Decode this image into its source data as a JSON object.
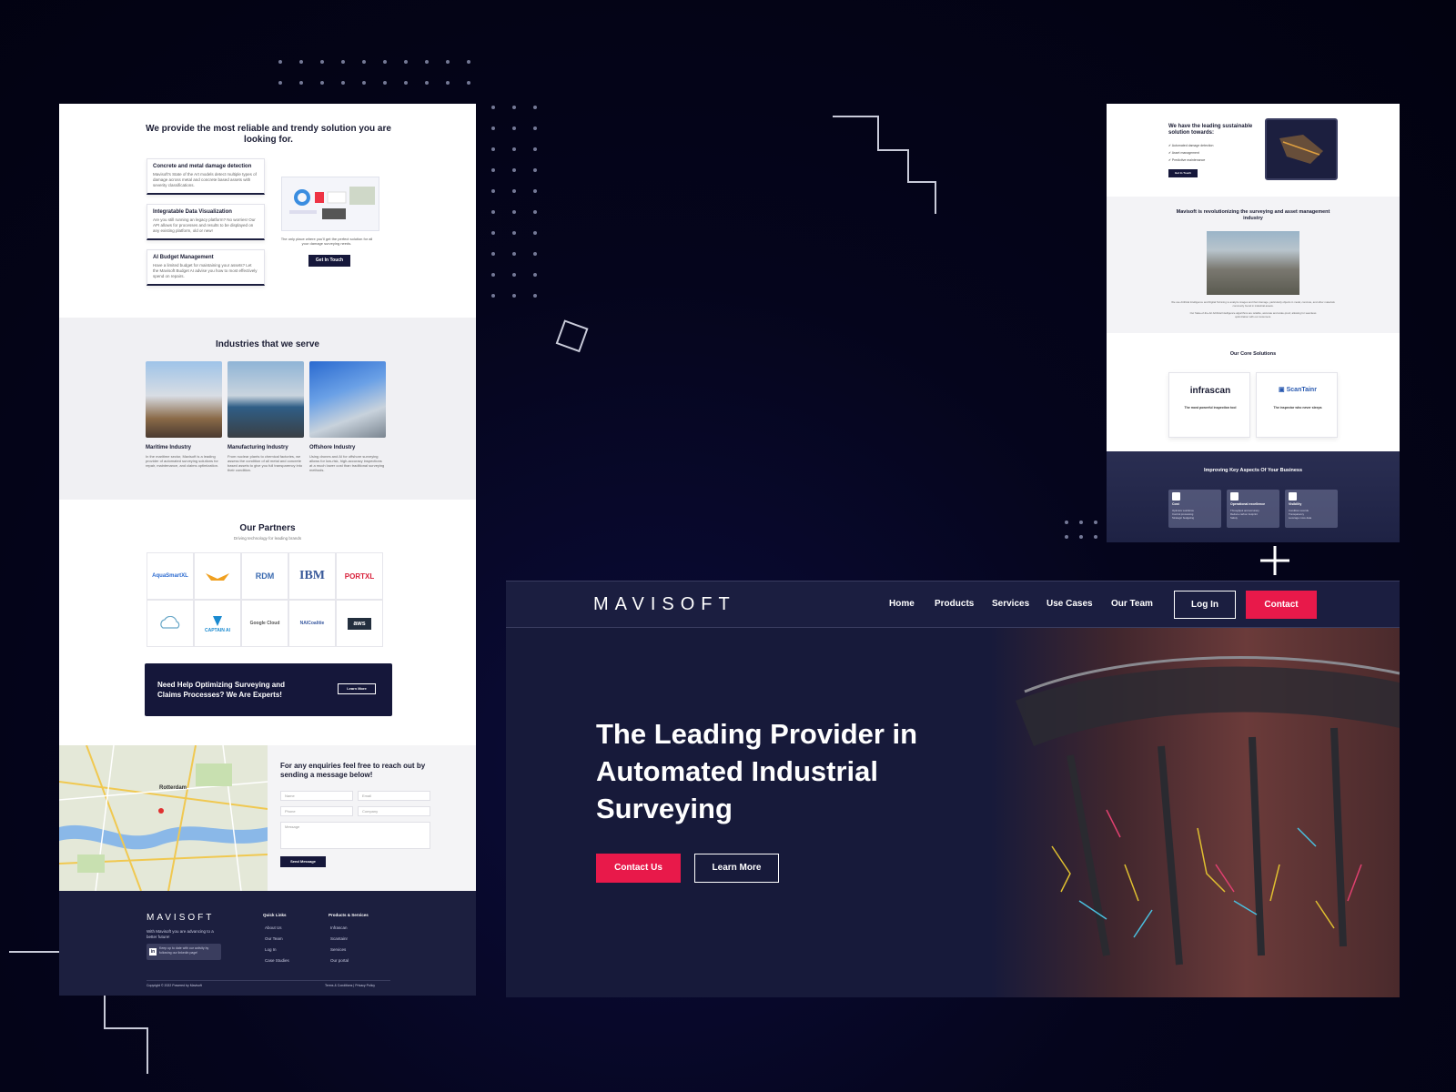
{
  "left_page": {
    "solution_title": "We provide the most reliable and trendy solution you are looking for.",
    "features": [
      {
        "title": "Concrete and metal damage detection",
        "text": "Mavisoft's State of the Art models detect multiple types of damage across metal and concrete based assets with severity classifications."
      },
      {
        "title": "Integratable Data Visualization",
        "text": "Are you still running an legacy platform? No worries! Our API allows for processes and results to be displayed on any existing platform, old or new!"
      },
      {
        "title": "AI Budget Management",
        "text": "Have a limited budget for maintaining your assets? Let the Mavisoft Budget AI advise you how to most effectively spend on repairs."
      }
    ],
    "dashboard_caption": "The only place where you'll get the perfect solution for all your damage surveying needs.",
    "get_in_touch": "Get In Touch",
    "industries_title": "Industries that we serve",
    "industries": [
      {
        "name": "Maritime Industry",
        "text": "In the maritime sector, Mavisoft is a leading provider of automated surveying solutions for repair, maintenance, and claims optimization."
      },
      {
        "name": "Manufacturing Industry",
        "text": "From nuclear plants to chemical factories, we assess the condition of all metal and concrete based assets to give you full transparency into their condition."
      },
      {
        "name": "Offshore Industry",
        "text": "Using drones and AI for offshore surveying allows for low-risk, high-accuracy inspections at a much lower cost than traditional surveying methods."
      }
    ],
    "partners_title": "Our Partners",
    "partners_subtitle": "Driving technology for leading brands",
    "partners": [
      "AquaSmartXL",
      "",
      "RDM",
      "IBM",
      "PORTXL",
      "",
      "CAPTAIN AI",
      "Google Cloud",
      "NAICoalitie",
      "aws"
    ],
    "cta_text_1": "Need Help Optimizing Surveying and",
    "cta_text_2": "Claims Processes? We Are Experts!",
    "cta_button": "Learn More",
    "map_label": "Rotterdam",
    "contact_title": "For any enquiries feel free to reach out by sending a message below!",
    "form": {
      "name": "Name",
      "email": "Email",
      "phone": "Phone",
      "company": "Company",
      "message": "Message",
      "send": "Send Message"
    },
    "footer": {
      "logo": "MAVISOFT",
      "tagline": "With Mavisoft you are advancing to a better future!",
      "linkedin_text": "Keep up to date with our activity by following our linkedin page!",
      "quick_links_title": "Quick Links",
      "quick_links": [
        "About Us",
        "Our Team",
        "Log In",
        "Case Studies"
      ],
      "products_title": "Products & Services",
      "products": [
        "Infrascan",
        "Scantainr",
        "Services",
        "Our portal"
      ],
      "copyright": "Copyright © 2022 Powered by Mavisoft",
      "terms": "Terms & Conditions | Privacy Policy"
    }
  },
  "right_page": {
    "leading_title": "We have the leading sustainable solution towards:",
    "leading_items": [
      "Automated damage detection",
      "Asset management",
      "Predictive maintenance"
    ],
    "get_in_touch": "Get In Touch",
    "revolution_title": "Mavisoft is revolutionizing the surveying and asset management industry",
    "revolution_text": "We use Artificial Intelligence and Digital Twinning to analyze images and their damage, particularly objects in metal, concrete, and other materials commonly found in industrial assets.",
    "revolution_text_2": "Our State-of-the-Art Artificial Intelligence algorithms are reliable, accurate and scale-proof, allowing for seamless optimization with our customers.",
    "core_title": "Our Core Solutions",
    "core": [
      {
        "name": "infrascan",
        "tag": "The most powerful inspection tool"
      },
      {
        "name": "ScanTainr",
        "tag": "The inspector who never sleeps"
      }
    ],
    "improve_title": "Improving Key Aspects Of Your Business",
    "improve": [
      {
        "title": "Cost",
        "items": [
          "Optimize workforce",
          "Control processing",
          "Strategic budgeting"
        ]
      },
      {
        "title": "Operational excellence",
        "items": [
          "Throughput and accuracy",
          "Reduce carbon footprint",
          "Safety"
        ]
      },
      {
        "title": "Visibility",
        "items": [
          "Condition records",
          "Transparency",
          "Leverage more data"
        ]
      }
    ]
  },
  "homepage": {
    "logo": "MAVISOFT",
    "nav": [
      "Home",
      "Products",
      "Services",
      "Use Cases",
      "Our Team"
    ],
    "login": "Log In",
    "contact": "Contact",
    "hero_line_1": "The Leading Provider in",
    "hero_line_2": "Automated Industrial",
    "hero_line_3": "Surveying",
    "contact_us": "Contact Us",
    "learn_more": "Learn More"
  },
  "colors": {
    "navy": "#1b1e40",
    "accent": "#e8194a",
    "dark": "#15173a"
  }
}
